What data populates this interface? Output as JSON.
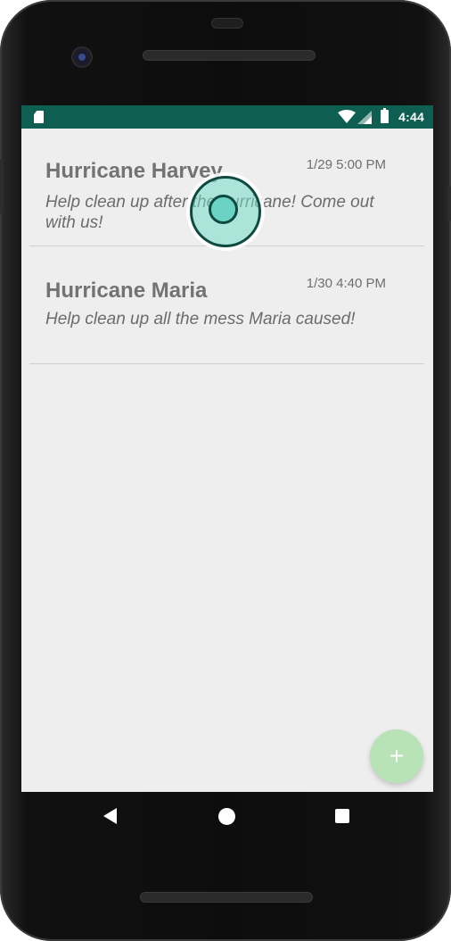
{
  "status_bar": {
    "time": "4:44",
    "icons": [
      "sd-card-icon",
      "wifi-icon",
      "cell-signal-icon",
      "battery-icon"
    ],
    "background_color": "#0f5e52"
  },
  "events": [
    {
      "title": "Hurricane Harvey",
      "datetime": "1/29 5:00 PM",
      "description": "Help clean up after the hurricane! Come out with us!"
    },
    {
      "title": "Hurricane Maria",
      "datetime": "1/30 4:40 PM",
      "description": "Help clean up all the mess Maria caused!"
    }
  ],
  "fab": {
    "symbol": "+",
    "color": "#b7e3b6"
  },
  "nav_bar": {
    "buttons": [
      "back-icon",
      "home-icon",
      "recent-apps-icon"
    ]
  }
}
